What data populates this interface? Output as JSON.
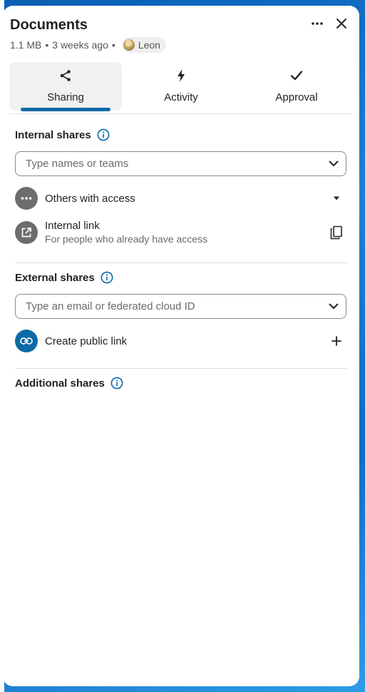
{
  "header": {
    "title": "Documents",
    "size": "1.1 MB",
    "modified": "3 weeks ago",
    "owner": "Leon",
    "more_icon": "more-horizontal-icon",
    "close_icon": "close-icon"
  },
  "tabs": [
    {
      "label": "Sharing",
      "icon": "share-icon",
      "active": true
    },
    {
      "label": "Activity",
      "icon": "lightning-icon",
      "active": false
    },
    {
      "label": "Approval",
      "icon": "check-icon",
      "active": false
    }
  ],
  "internal": {
    "title": "Internal shares",
    "search_placeholder": "Type names or teams",
    "others_label": "Others with access",
    "link_title": "Internal link",
    "link_subtitle": "For people who already have access"
  },
  "external": {
    "title": "External shares",
    "search_placeholder": "Type an email or federated cloud ID",
    "public_link_label": "Create public link"
  },
  "additional": {
    "title": "Additional shares"
  },
  "colors": {
    "accent": "#0b6aa7",
    "grey_circle": "#6d6d6d",
    "desktop": "#1b7fd6"
  }
}
